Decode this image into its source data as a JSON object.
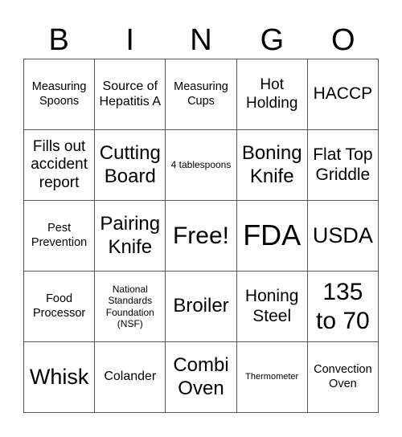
{
  "header": [
    "B",
    "I",
    "N",
    "G",
    "O"
  ],
  "cells": [
    "Measuring Spoons",
    "Source of Hepatitis A",
    "Measuring Cups",
    "Hot Holding",
    "HACCP",
    "Fills out accident report",
    "Cutting Board",
    "4 tablespoons",
    "Boning Knife",
    "Flat Top Griddle",
    "Pest Prevention",
    "Pairing Knife",
    "Free!",
    "FDA",
    "USDA",
    "Food Processor",
    "National Standards Foundation (NSF)",
    "Broiler",
    "Honing Steel",
    "135 to 70",
    "Whisk",
    "Colander",
    "Combi Oven",
    "Thermometer",
    "Convection Oven"
  ]
}
